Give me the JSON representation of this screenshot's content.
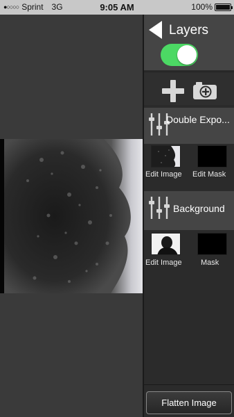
{
  "status_bar": {
    "carrier": "Sprint",
    "network": "3G",
    "time": "9:05 AM",
    "battery": "100%"
  },
  "panel": {
    "title": "Layers",
    "visibility_toggle": true,
    "layers": [
      {
        "name": "Double Expo...",
        "image_label": "Edit Image",
        "mask_label": "Edit Mask"
      },
      {
        "name": "Background",
        "image_label": "Edit Image",
        "mask_label": "Mask"
      }
    ],
    "flatten_label": "Flatten Image"
  },
  "icons": {
    "back": "back-arrow-icon",
    "add": "plus-icon",
    "camera": "camera-add-icon",
    "adjust": "sliders-icon"
  },
  "colors": {
    "toggle_on": "#4cd964",
    "panel_bg": "#2b2b2b",
    "header_bg": "#454545"
  }
}
